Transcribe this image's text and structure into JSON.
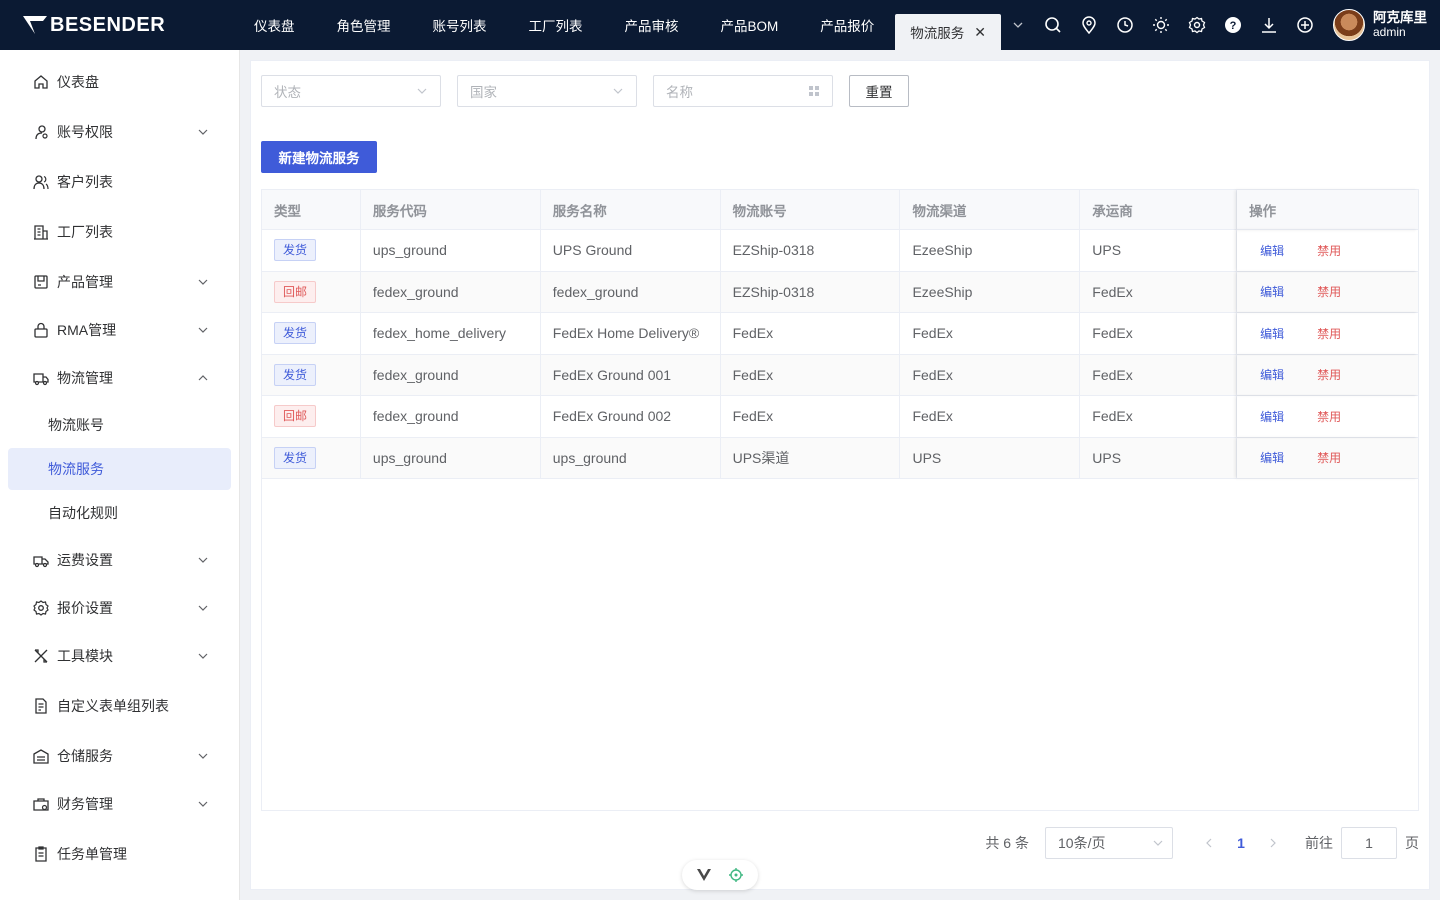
{
  "brand": {
    "name": "BESENDER"
  },
  "nav": {
    "items": [
      "仪表盘",
      "角色管理",
      "账号列表",
      "工厂列表",
      "产品审核",
      "产品BOM",
      "产品报价"
    ],
    "active_tab": "物流服务"
  },
  "user": {
    "name": "阿克库里",
    "role": "admin"
  },
  "top_icons": [
    "search-icon",
    "location-icon",
    "clock-icon",
    "sun-icon",
    "gear-icon",
    "help-icon",
    "download-icon",
    "plus-circle-icon"
  ],
  "sidebar": {
    "items": [
      {
        "label": "仪表盘",
        "icon": "home-icon"
      },
      {
        "label": "账号权限",
        "icon": "user-key-icon"
      },
      {
        "label": "客户列表",
        "icon": "users-icon"
      },
      {
        "label": "工厂列表",
        "icon": "building-icon"
      },
      {
        "label": "产品管理",
        "icon": "box-icon"
      },
      {
        "label": "RMA管理",
        "icon": "lock-box-icon"
      },
      {
        "label": "物流管理",
        "icon": "truck-icon"
      },
      {
        "label": "运费设置",
        "icon": "freight-icon"
      },
      {
        "label": "报价设置",
        "icon": "settings-icon"
      },
      {
        "label": "工具模块",
        "icon": "tools-icon"
      },
      {
        "label": "自定义表单组列表",
        "icon": "form-icon"
      },
      {
        "label": "仓储服务",
        "icon": "warehouse-icon"
      },
      {
        "label": "财务管理",
        "icon": "finance-icon"
      },
      {
        "label": "任务单管理",
        "icon": "task-icon"
      }
    ],
    "sub_items": [
      "物流账号",
      "物流服务",
      "自动化规则"
    ]
  },
  "filters": {
    "status_placeholder": "状态",
    "country_placeholder": "国家",
    "name_placeholder": "名称",
    "reset_label": "重置"
  },
  "create_button_label": "新建物流服务",
  "table": {
    "headers": [
      "类型",
      "服务代码",
      "服务名称",
      "物流账号",
      "物流渠道",
      "承运商",
      "操作"
    ],
    "rows": [
      {
        "type": "发货",
        "kind": "ship",
        "code": "ups_ground",
        "name": "UPS Ground",
        "account": "EZShip-0318",
        "channel": "EzeeShip",
        "carrier": "UPS"
      },
      {
        "type": "回邮",
        "kind": "return",
        "code": "fedex_ground",
        "name": "fedex_ground",
        "account": "EZShip-0318",
        "channel": "EzeeShip",
        "carrier": "FedEx"
      },
      {
        "type": "发货",
        "kind": "ship",
        "code": "fedex_home_delivery",
        "name": "FedEx Home Delivery®",
        "account": "FedEx",
        "channel": "FedEx",
        "carrier": "FedEx"
      },
      {
        "type": "发货",
        "kind": "ship",
        "code": "fedex_ground",
        "name": "FedEx Ground 001",
        "account": "FedEx",
        "channel": "FedEx",
        "carrier": "FedEx"
      },
      {
        "type": "回邮",
        "kind": "return",
        "code": "fedex_ground",
        "name": "FedEx Ground 002",
        "account": "FedEx",
        "channel": "FedEx",
        "carrier": "FedEx"
      },
      {
        "type": "发货",
        "kind": "ship",
        "code": "ups_ground",
        "name": "ups_ground",
        "account": "UPS渠道",
        "channel": "UPS",
        "carrier": "UPS"
      }
    ],
    "edit_label": "编辑",
    "disable_label": "禁用"
  },
  "pagination": {
    "total_text": "共 6 条",
    "page_size": "10条/页",
    "current_page": "1",
    "goto_label": "前往",
    "goto_value": "1",
    "page_suffix": "页"
  },
  "colors": {
    "primary": "#3f5bd9",
    "danger": "#e05a5a",
    "topbar": "#0b1a33"
  }
}
